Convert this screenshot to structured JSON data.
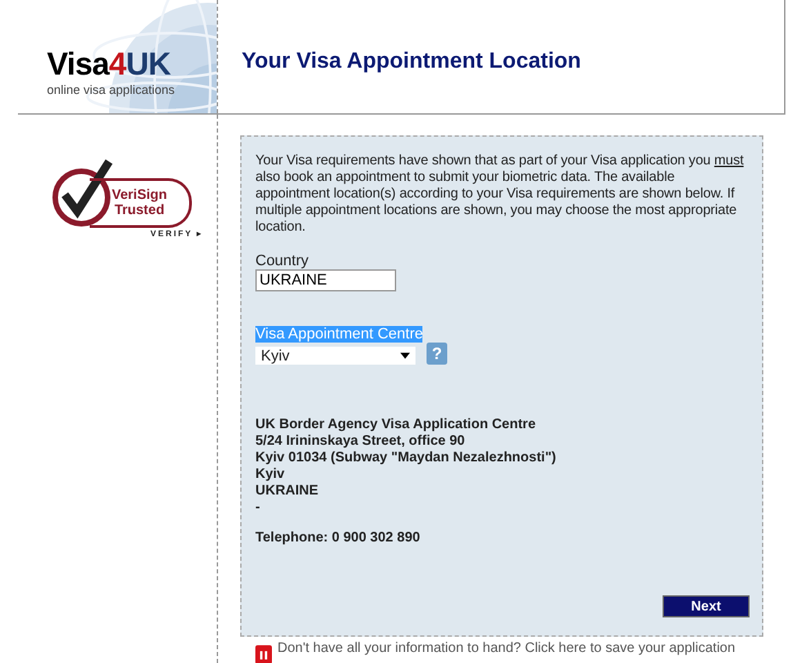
{
  "logo": {
    "parts": [
      "Visa",
      "4",
      "UK"
    ],
    "tagline": "online visa applications"
  },
  "page_title": "Your Visa Appointment Location",
  "trust_badge": {
    "line_1": "VeriSign",
    "line_2": "Trusted",
    "verify": "VERIFY",
    "verify_arrow": "▸"
  },
  "intro": {
    "before": "Your Visa requirements have shown that as part of your Visa application you ",
    "underlined": "must",
    "after": " also book an appointment to submit your biometric data.  The available appointment location(s) according to your Visa requirements are shown below.  If multiple appointment locations are shown, you may choose the most appropriate location."
  },
  "country": {
    "label": "Country",
    "value": "UKRAINE"
  },
  "centre": {
    "label": "Visa Appointment Centre",
    "highlighted": true,
    "value": "Kyiv",
    "help": "?"
  },
  "address": [
    "UK Border Agency Visa Application Centre",
    "5/24 Irininskaya Street, office 90",
    "Kyiv 01034 (Subway \"Maydan Nezalezhnosti\")",
    "Kyiv",
    "UKRAINE",
    "-"
  ],
  "telephone": "Telephone: 0 900 302 890",
  "next_button": "Next",
  "save_link": "Don't have all your information to hand? Click here to save your application"
}
